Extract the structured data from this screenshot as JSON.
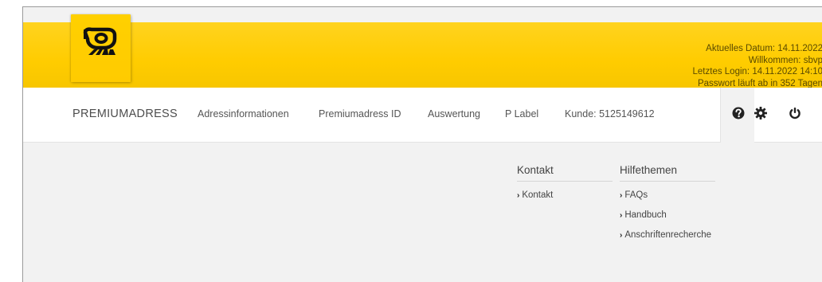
{
  "header": {
    "user_info": {
      "current_date": "Aktuelles Datum: 14.11.2022",
      "welcome": "Willkommen: sbvp",
      "last_login": "Letztes Login: 14.11.2022 14:10",
      "password_expiry": "Passwort läuft ab in 352 Tagen"
    }
  },
  "nav": {
    "brand": "PREMIUMADRESS",
    "items": [
      {
        "label": "Adressinformationen"
      },
      {
        "label": "Premiumadress ID"
      },
      {
        "label": "Auswertung"
      },
      {
        "label": "P Label"
      }
    ],
    "customer": "Kunde: 5125149612",
    "icons": [
      "help-icon",
      "gear-icon",
      "power-icon"
    ]
  },
  "help_menu": {
    "contact": {
      "heading": "Kontakt",
      "links": [
        {
          "label": "Kontakt"
        }
      ]
    },
    "topics": {
      "heading": "Hilfethemen",
      "links": [
        {
          "label": "FAQs"
        },
        {
          "label": "Handbuch"
        },
        {
          "label": "Anschriftenrecherche"
        }
      ]
    }
  },
  "colors": {
    "brand_yellow": "#ffcc00",
    "nav_background": "#ffffff",
    "content_background": "#f2f2f2",
    "text": "#444444"
  }
}
